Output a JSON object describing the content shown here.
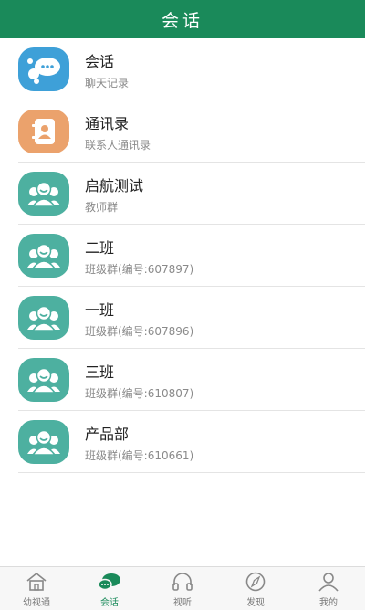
{
  "header": {
    "title": "会话"
  },
  "colors": {
    "brand": "#1a8a5a",
    "chat_icon": "#3ea0d8",
    "contacts_icon": "#eba26c",
    "group_icon": "#4db0a0"
  },
  "conversations": [
    {
      "title": "会话",
      "subtitle": "聊天记录",
      "icon": "chat-bubble-icon"
    },
    {
      "title": "通讯录",
      "subtitle": "联系人通讯录",
      "icon": "contacts-book-icon"
    },
    {
      "title": "启航测试",
      "subtitle": "教师群",
      "icon": "group-icon"
    },
    {
      "title": "二班",
      "subtitle": "班级群(编号:607897)",
      "icon": "group-icon"
    },
    {
      "title": "一班",
      "subtitle": "班级群(编号:607896)",
      "icon": "group-icon"
    },
    {
      "title": "三班",
      "subtitle": "班级群(编号:610807)",
      "icon": "group-icon"
    },
    {
      "title": "产品部",
      "subtitle": "班级群(编号:610661)",
      "icon": "group-icon"
    }
  ],
  "tabbar": {
    "tabs": [
      {
        "label": "幼视通",
        "icon": "home-icon"
      },
      {
        "label": "会话",
        "icon": "chat-icon",
        "active": true
      },
      {
        "label": "视听",
        "icon": "headphones-icon"
      },
      {
        "label": "发现",
        "icon": "compass-icon"
      },
      {
        "label": "我的",
        "icon": "user-icon"
      }
    ]
  }
}
